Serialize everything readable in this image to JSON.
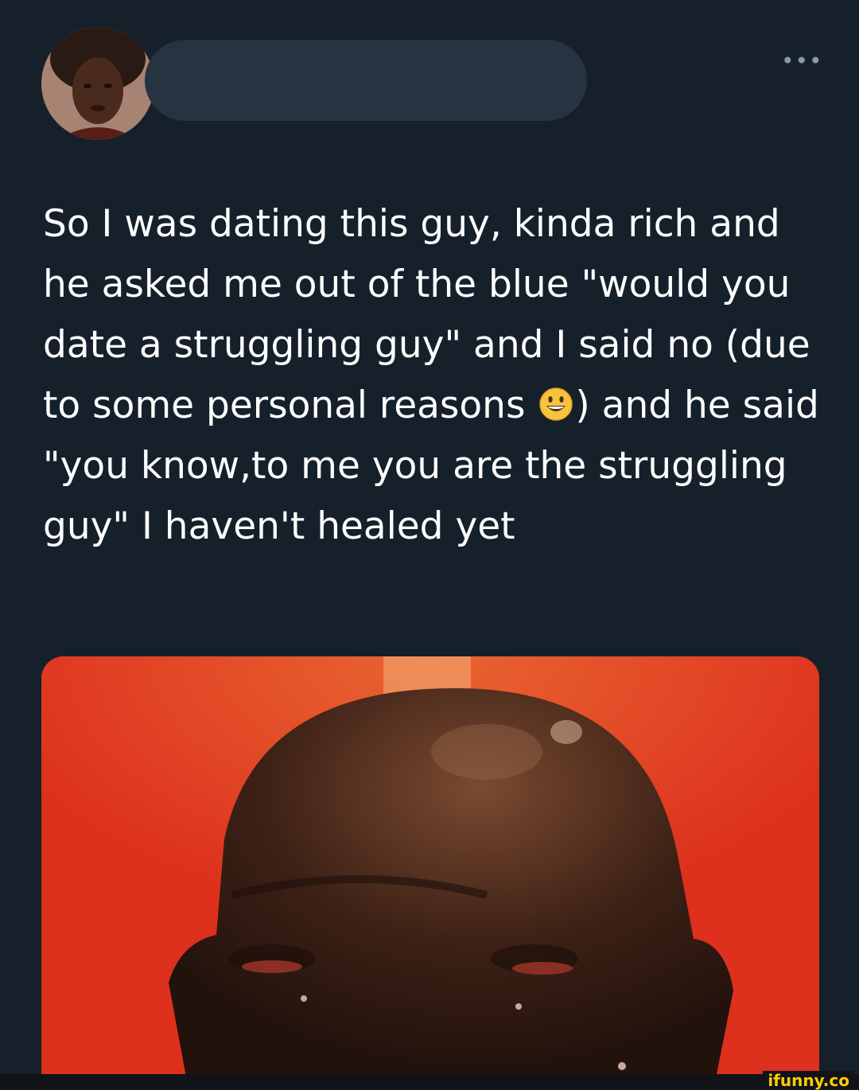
{
  "tweet": {
    "more_icon": "more-horizontal-icon",
    "more_label": "•••",
    "text_before_emoji": "So I was dating this guy, kinda rich and he asked me out of the blue \"would you date a struggling guy\" and I said no (due to some personal reasons ",
    "emoji": "grinning-face-emoji",
    "text_after_emoji": ") and he said \"you know,to me you are the struggling guy\" I haven't healed yet"
  },
  "watermark": {
    "label": "ifunny.co"
  },
  "colors": {
    "background": "#15202b",
    "text": "#ffffff",
    "redaction": "#273340",
    "media_background": "#e23a22",
    "watermark": "#ffcc00"
  }
}
